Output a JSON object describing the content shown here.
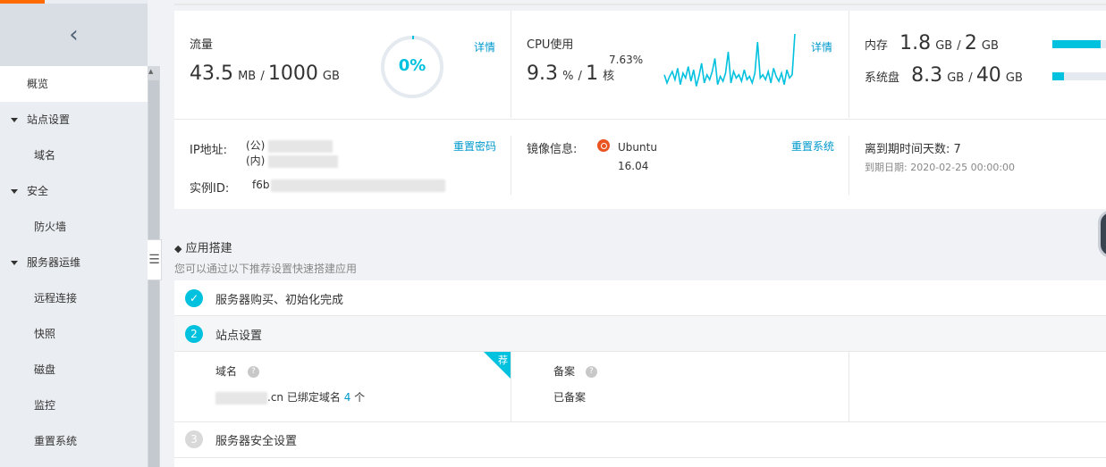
{
  "sidebar": {
    "collapse_glyph": "‹",
    "items": [
      {
        "label": "概览",
        "type": "active"
      },
      {
        "label": "站点设置",
        "type": "group"
      },
      {
        "label": "域名",
        "type": "sub"
      },
      {
        "label": "安全",
        "type": "group"
      },
      {
        "label": "防火墙",
        "type": "sub"
      },
      {
        "label": "服务器运维",
        "type": "group"
      },
      {
        "label": "远程连接",
        "type": "sub"
      },
      {
        "label": "快照",
        "type": "sub"
      },
      {
        "label": "磁盘",
        "type": "sub"
      },
      {
        "label": "监控",
        "type": "sub"
      },
      {
        "label": "重置系统",
        "type": "sub"
      }
    ]
  },
  "traffic": {
    "label": "流量",
    "used": "43.5",
    "used_unit": "MB",
    "total": "1000",
    "total_unit": "GB",
    "percent_text": "0%",
    "percent_value": 0.01,
    "detail_link": "详情"
  },
  "cpu": {
    "label": "CPU使用",
    "value": "9.3",
    "value_unit": "%",
    "cores": "1",
    "cores_unit": "核",
    "current": "7.63%",
    "detail_link": "详情",
    "sparkline": [
      10,
      5,
      9,
      12,
      7,
      14,
      4,
      11,
      8,
      15,
      6,
      13,
      3,
      9,
      17,
      5,
      10,
      7,
      12,
      20,
      4,
      9,
      6,
      11,
      24,
      5,
      12,
      8,
      10,
      6,
      13,
      7,
      9,
      5,
      11,
      30,
      8,
      10,
      7,
      12,
      5,
      14,
      9,
      6,
      11,
      4,
      13,
      8,
      10,
      35
    ]
  },
  "memory": {
    "label": "内存",
    "used": "1.8",
    "used_unit": "GB",
    "total": "2",
    "total_unit": "GB",
    "fraction": 0.9
  },
  "disk": {
    "label": "系统盘",
    "used": "8.3",
    "used_unit": "GB",
    "total": "40",
    "total_unit": "GB",
    "fraction": 0.21
  },
  "instance": {
    "ip_label": "IP地址:",
    "ip_public_prefix": "(公)",
    "ip_private_prefix": "(内)",
    "reset_password": "重置密码",
    "id_label": "实例ID:",
    "id_prefix": "f6b"
  },
  "image": {
    "label": "镜像信息:",
    "os_name": "Ubuntu",
    "os_version": "16.04",
    "reset_system": "重置系统"
  },
  "expiry": {
    "days_label": "离到期时间天数:",
    "days": "7",
    "date_label": "到期日期:",
    "date": "2020-02-25 00:00:00"
  },
  "app_section": {
    "title": "应用搭建",
    "subtitle": "您可以通过以下推荐设置快速搭建应用"
  },
  "steps": [
    {
      "num": "✓",
      "label": "服务器购买、初始化完成"
    },
    {
      "num": "2",
      "label": "站点设置"
    },
    {
      "num": "3",
      "label": "服务器安全设置"
    }
  ],
  "site_settings": {
    "domain_label": "域名",
    "domain_suffix": ".cn",
    "bound_text": "已绑定域名",
    "bound_count": "4",
    "bound_unit": "个",
    "recommend_badge": "荐",
    "filing_label": "备案",
    "filing_status": "已备案",
    "help_glyph": "?"
  },
  "colors": {
    "accent": "#00c1de",
    "link": "#0099cc",
    "brand_orange": "#ff6a00",
    "ubuntu": "#e95420"
  }
}
